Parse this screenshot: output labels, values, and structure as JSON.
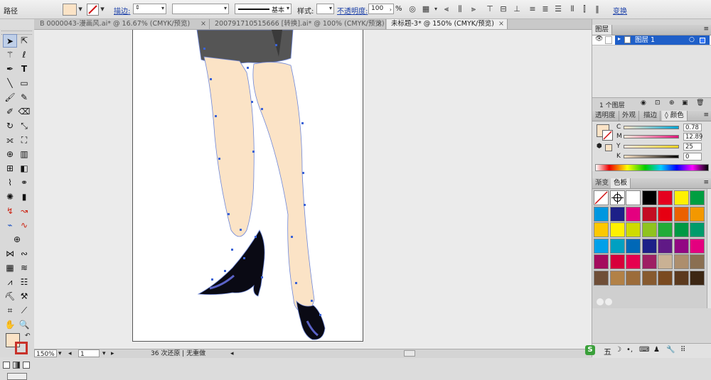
{
  "control_bar": {
    "object_label": "路径",
    "fill_color": "#fbe3c6",
    "stroke_label": "描边:",
    "stroke_width_value": "",
    "brush_value": "",
    "stroke_profile_value": "基本",
    "style_label": "样式:",
    "opacity_label": "不透明度:",
    "opacity_value": "100",
    "percent": "%",
    "transform_label": "变换"
  },
  "tabs": [
    {
      "label": "B 0000043-漫画风.ai* @ 16.67% (CMYK/预览)",
      "close": "×",
      "active": false
    },
    {
      "label": "200791710515666 [转换].ai* @ 100% (CMYK/预览)",
      "close": "×",
      "active": false
    },
    {
      "label": "未标题-3* @ 150% (CMYK/预览)",
      "close": "×",
      "active": true
    }
  ],
  "tools": {
    "fill_color": "#fbe3c6",
    "stroke_color": "#c8322a"
  },
  "status_bar": {
    "zoom_value": "150%",
    "page_value": "1",
    "status_text": "36 次还原 | 无重做"
  },
  "layers_panel": {
    "title": "图层",
    "layer_name": "图层 1",
    "layer_count": "1 个图层",
    "layer_color": "#1f5fc8"
  },
  "color_panel": {
    "tabs": [
      "透明度",
      "外观",
      "描边",
      "颜色"
    ],
    "active_tab": 3,
    "channels": [
      {
        "label": "C",
        "value": "0.78"
      },
      {
        "label": "M",
        "value": "12.89"
      },
      {
        "label": "Y",
        "value": "25"
      },
      {
        "label": "K",
        "value": "0"
      }
    ]
  },
  "swatches_panel": {
    "tabs": [
      "渐变",
      "色板"
    ],
    "active_tab": 1,
    "rows": [
      [
        "none",
        "registration",
        "#ffffff",
        "#000000",
        "#e5001f",
        "#fff100",
        "#009e41"
      ],
      [
        "#0097e0",
        "#1d2088",
        "#e4007f",
        "#c30d23",
        "#e60012",
        "#eb6100",
        "#f39800"
      ],
      [
        "#fcc800",
        "#fff100",
        "#cfdb00",
        "#8fc31f",
        "#22ac38",
        "#009944",
        "#009b6b"
      ],
      [
        "#00a0e9",
        "#00a0c1",
        "#0068b7",
        "#1d2088",
        "#601986",
        "#920783",
        "#e4007f"
      ],
      [
        "#a40b5d",
        "#d7003a",
        "#e5004f",
        "#9e1f63",
        "#c9b194",
        "#ad8e6d",
        "#8a6f52"
      ],
      [
        "#6f4e37",
        "#b28146",
        "#9c6c3a",
        "#875a2f",
        "#7a4a20",
        "#5c3a1e",
        "#3d2713"
      ]
    ]
  },
  "taskbar": {
    "ime_label": "五"
  }
}
